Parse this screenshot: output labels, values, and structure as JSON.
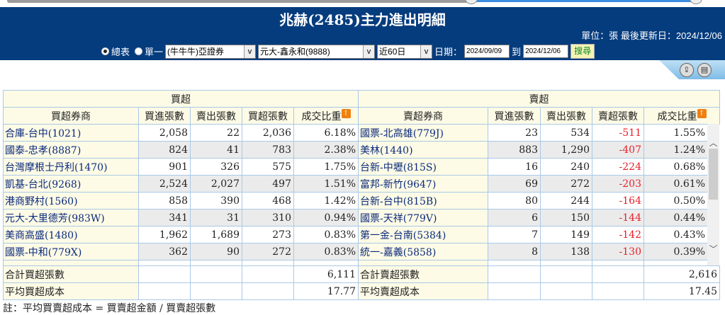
{
  "header": {
    "title": "兆赫(2485)主力進出明細",
    "unit_label": "單位：張",
    "updated_label": "最後更新日：2024/12/06"
  },
  "controls": {
    "radio_summary": "總表",
    "radio_single": "單一",
    "broker_group": "(牛牛牛)亞證券",
    "broker": "元大-鑫永和(9888)",
    "period": "近60日",
    "date_label": "日期：",
    "date_from": "2024/09/09",
    "to_label": "到",
    "date_to": "2024/12/06",
    "search_label": "搜尋"
  },
  "table": {
    "buy_title": "買超",
    "sell_title": "賣超",
    "buy_headers": [
      "買超券商",
      "買進張數",
      "賣出張數",
      "買超張數",
      "成交比重"
    ],
    "sell_headers": [
      "賣超券商",
      "買進張數",
      "賣出張數",
      "賣超張數",
      "成交比重"
    ],
    "rows": [
      {
        "buy": [
          "合庫-台中(1021)",
          "2,058",
          "22",
          "2,036",
          "6.18%"
        ],
        "sell": [
          "國票-北高雄(779J)",
          "23",
          "534",
          "-511",
          "1.55%"
        ]
      },
      {
        "buy": [
          "國泰-忠孝(8887)",
          "824",
          "41",
          "783",
          "2.38%"
        ],
        "sell": [
          "美林(1440)",
          "883",
          "1,290",
          "-407",
          "1.24%"
        ]
      },
      {
        "buy": [
          "台灣摩根士丹利(1470)",
          "901",
          "326",
          "575",
          "1.75%"
        ],
        "sell": [
          "台新-中壢(815S)",
          "16",
          "240",
          "-224",
          "0.68%"
        ]
      },
      {
        "buy": [
          "凱基-台北(9268)",
          "2,524",
          "2,027",
          "497",
          "1.51%"
        ],
        "sell": [
          "富邦-新竹(9647)",
          "69",
          "272",
          "-203",
          "0.61%"
        ]
      },
      {
        "buy": [
          "港商野村(1560)",
          "858",
          "390",
          "468",
          "1.42%"
        ],
        "sell": [
          "台新-台中(815B)",
          "80",
          "244",
          "-164",
          "0.50%"
        ]
      },
      {
        "buy": [
          "元大-大里德芳(983W)",
          "341",
          "31",
          "310",
          "0.94%"
        ],
        "sell": [
          "國票-天祥(779V)",
          "6",
          "150",
          "-144",
          "0.44%"
        ]
      },
      {
        "buy": [
          "美商高盛(1480)",
          "1,962",
          "1,689",
          "273",
          "0.83%"
        ],
        "sell": [
          "第一金-台南(5384)",
          "7",
          "149",
          "-142",
          "0.43%"
        ]
      },
      {
        "buy": [
          "國票-中和(779X)",
          "362",
          "90",
          "272",
          "0.83%"
        ],
        "sell": [
          "統一-嘉義(5858)",
          "8",
          "138",
          "-130",
          "0.39%"
        ]
      }
    ],
    "totals": [
      {
        "buy_label": "合計買超張數",
        "buy_value": "6,111",
        "sell_label": "合計賣超張數",
        "sell_value": "2,616"
      },
      {
        "buy_label": "平均買超成本",
        "buy_value": "17.77",
        "sell_label": "平均賣超成本",
        "sell_value": "17.45"
      }
    ]
  },
  "note": "註：平均買賣超成本 = 買賣超金額 / 買賣超張數",
  "colors": {
    "header_bg": "#053c7e",
    "negative": "#e8202a",
    "name_text": "#0b2a7c"
  }
}
